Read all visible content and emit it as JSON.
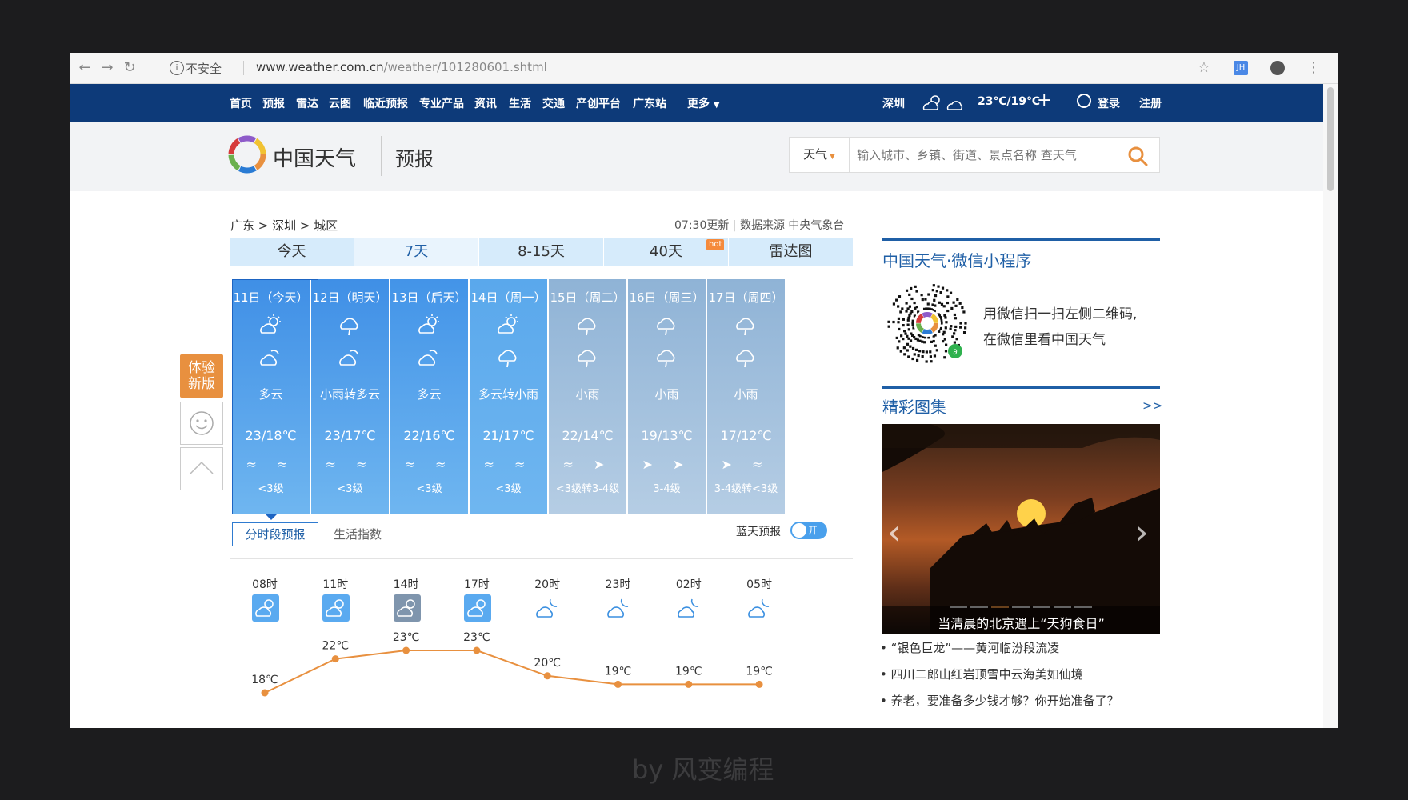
{
  "browser": {
    "security": "不安全",
    "url_host": "www.weather.com.cn",
    "url_path": "/weather/101280601.shtml",
    "profile": "JH"
  },
  "nav": {
    "items": [
      "首页",
      "预报",
      "雷达",
      "云图",
      "临近预报",
      "专业产品",
      "资讯",
      "生活",
      "交通",
      "产创平台",
      "广东站"
    ],
    "more": "更多",
    "city": "深圳",
    "temp": "23℃/19℃",
    "plus": "+",
    "login": "登录",
    "register": "注册"
  },
  "header": {
    "logo_text": "中国天气",
    "section": "预报",
    "search_type": "天气",
    "search_placeholder": "输入城市、乡镇、街道、景点名称 查天气"
  },
  "breadcrumb": {
    "province": "广东",
    "city": "深圳",
    "district": "城区",
    "update": "07:30更新",
    "source": "数据来源 中央气象台"
  },
  "tabs": [
    "今天",
    "7天",
    "8-15天",
    "40天",
    "雷达图"
  ],
  "hot_badge": "hot",
  "days": [
    {
      "date": "11日（今天）",
      "icon1": "sun-cloud",
      "icon2": "cloud",
      "weather": "多云",
      "temp": "23/18℃",
      "wind": "≈ ≈",
      "level": "<3级",
      "color": "#3f8fe6"
    },
    {
      "date": "12日（明天）",
      "icon1": "rain",
      "icon2": "cloud",
      "weather": "小雨转多云",
      "temp": "23/17℃",
      "wind": "≈ ≈",
      "level": "<3级",
      "color": "#3f8fe6"
    },
    {
      "date": "13日（后天）",
      "icon1": "sun-cloud",
      "icon2": "cloud",
      "weather": "多云",
      "temp": "22/16℃",
      "wind": "≈ ≈",
      "level": "<3级",
      "color": "#4394e8"
    },
    {
      "date": "14日（周一）",
      "icon1": "sun-cloud",
      "icon2": "rain",
      "weather": "多云转小雨",
      "temp": "21/17℃",
      "wind": "≈ ≈",
      "level": "<3级",
      "color": "#5aa8ec"
    },
    {
      "date": "15日（周二）",
      "icon1": "rain",
      "icon2": "rain",
      "weather": "小雨",
      "temp": "22/14℃",
      "wind": "≈ ➤",
      "level": "<3级转3-4级",
      "color": "#8fb3d6"
    },
    {
      "date": "16日（周三）",
      "icon1": "rain",
      "icon2": "rain",
      "weather": "小雨",
      "temp": "19/13℃",
      "wind": "➤ ➤",
      "level": "3-4级",
      "color": "#8fb3d6"
    },
    {
      "date": "17日（周四）",
      "icon1": "rain",
      "icon2": "rain",
      "weather": "小雨",
      "temp": "17/12℃",
      "wind": "➤ ≈",
      "level": "3-4级转<3级",
      "color": "#8fb3d6"
    }
  ],
  "floating": {
    "new_version": "体验\n新版"
  },
  "subtabs": {
    "hourly": "分时段预报",
    "life": "生活指数",
    "bluesky": "蓝天预报",
    "toggle": "开"
  },
  "hourly": {
    "hours": [
      "08时",
      "11时",
      "14时",
      "17时",
      "20时",
      "23时",
      "02时",
      "05时"
    ],
    "temps": [
      "18℃",
      "22℃",
      "23℃",
      "23℃",
      "20℃",
      "19℃",
      "19℃",
      "19℃"
    ],
    "temp_values": [
      18,
      22,
      23,
      23,
      20,
      19,
      19,
      19
    ],
    "icons": [
      "day-cloud",
      "day-cloud",
      "day-cloud-gray",
      "day-cloud",
      "night-cloud",
      "night-cloud",
      "night-cloud",
      "night-cloud"
    ]
  },
  "sidebar": {
    "wechat_title": "中国天气·微信小程序",
    "wechat_text1": "用微信扫一扫左侧二维码,",
    "wechat_text2": "在微信里看中国天气",
    "gallery_title": "精彩图集",
    "gallery_more": ">>",
    "gallery_caption": "当清晨的北京遇上“天狗食日”",
    "news": [
      "“银色巨龙”——黄河临汾段流凌",
      "四川二郎山红岩顶雪中云海美如仙境",
      "养老，要准备多少钱才够？你开始准备了？"
    ]
  },
  "watermark": "by 风变编程",
  "colors": {
    "nav": "#0d3a79",
    "accent": "#e8903f",
    "link": "#1f5fa6"
  }
}
